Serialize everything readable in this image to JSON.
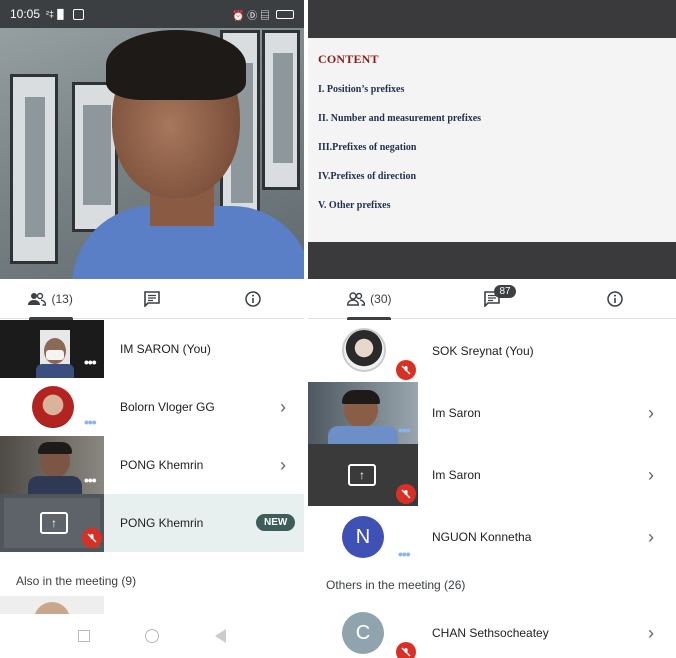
{
  "left": {
    "status_bar": {
      "time": "10:05",
      "left_icons": "²‡▐▌",
      "right_icons": "⏰ Ⓓ ▤"
    },
    "tabs": {
      "people_count": "(13)"
    },
    "rows": [
      {
        "name": "IM SARON (You)"
      },
      {
        "name": "Bolorn Vloger GG"
      },
      {
        "name": "PONG Khemrin"
      },
      {
        "name": "PONG Khemrin",
        "chip": "NEW"
      }
    ],
    "section_label": "Also in the meeting (9)"
  },
  "right": {
    "slide": {
      "title": "CONTENT",
      "items": [
        "I.   Position’s prefixes",
        "II.  Number and measurement prefixes",
        "III.Prefixes of negation",
        "IV.Prefixes of direction",
        "V.   Other prefixes"
      ]
    },
    "tabs": {
      "people_count": "(30)",
      "chat_badge": "87"
    },
    "rows": [
      {
        "name": "SOK Sreynat (You)"
      },
      {
        "name": "Im Saron"
      },
      {
        "name": "Im Saron"
      },
      {
        "name": "NGUON Konnetha",
        "avatar_letter": "N"
      }
    ],
    "section_label": "Others in the meeting (26)",
    "others": [
      {
        "name": "CHAN Sethsocheatey",
        "avatar_letter": "C"
      }
    ]
  },
  "colors": {
    "mute_red": "#d93025",
    "avatar_blue": "#3f51b5",
    "avatar_grey": "#90a4ae",
    "new_chip": "#3c5d5a",
    "slide_title": "#8b1c1c"
  }
}
